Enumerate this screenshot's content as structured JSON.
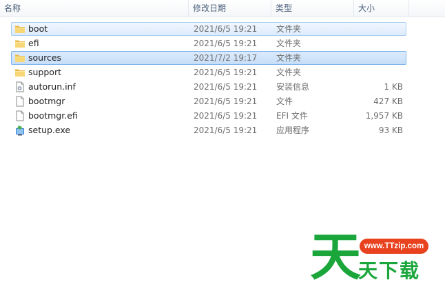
{
  "columns": {
    "name": "名称",
    "date": "修改日期",
    "type": "类型",
    "size": "大小"
  },
  "files": [
    {
      "name": "boot",
      "date": "2021/6/5 19:21",
      "type": "文件夹",
      "size": "",
      "icon": "folder-icon",
      "state": "hover"
    },
    {
      "name": "efi",
      "date": "2021/6/5 19:21",
      "type": "文件夹",
      "size": "",
      "icon": "folder-icon",
      "state": ""
    },
    {
      "name": "sources",
      "date": "2021/7/2 19:17",
      "type": "文件夹",
      "size": "",
      "icon": "folder-icon",
      "state": "selected"
    },
    {
      "name": "support",
      "date": "2021/6/5 19:21",
      "type": "文件夹",
      "size": "",
      "icon": "folder-icon",
      "state": ""
    },
    {
      "name": "autorun.inf",
      "date": "2021/6/5 19:21",
      "type": "安装信息",
      "size": "1 KB",
      "icon": "settings-file-icon",
      "state": ""
    },
    {
      "name": "bootmgr",
      "date": "2021/6/5 19:21",
      "type": "文件",
      "size": "427 KB",
      "icon": "blank-file-icon",
      "state": ""
    },
    {
      "name": "bootmgr.efi",
      "date": "2021/6/5 19:21",
      "type": "EFI 文件",
      "size": "1,957 KB",
      "icon": "blank-file-icon",
      "state": ""
    },
    {
      "name": "setup.exe",
      "date": "2021/6/5 19:21",
      "type": "应用程序",
      "size": "93 KB",
      "icon": "setup-exe-icon",
      "state": ""
    }
  ],
  "watermark": {
    "big": "天",
    "url": "www.TTzip.com",
    "small": "天下载"
  },
  "colors": {
    "selection": "#c6def8",
    "hover": "#dcebfc",
    "watermark_green": "#1aa63a",
    "watermark_red": "#e8421e"
  }
}
